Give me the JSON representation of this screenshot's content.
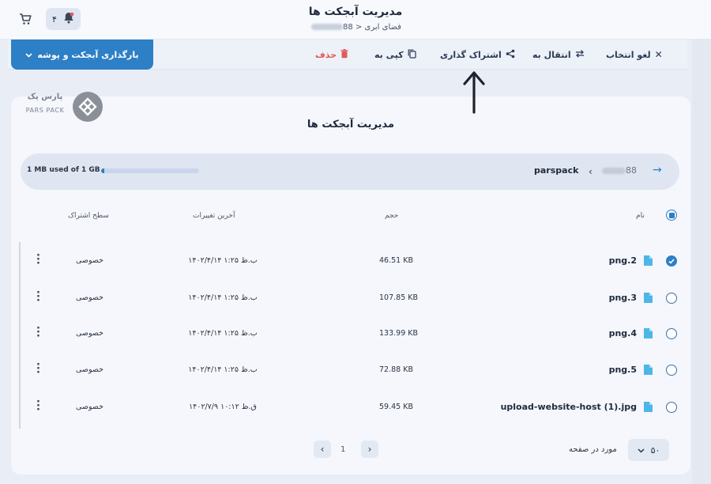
{
  "header": {
    "title": "مدیریت آبجکت ها",
    "breadcrumb_root": "فضای ابری",
    "breadcrumb_sep": "<",
    "breadcrumb_id_suffix": "88",
    "notification_count": "۴"
  },
  "toolbar": {
    "upload_label": "بارگذاری آبجکت و پوشه",
    "deselect_label": "لغو انتخاب",
    "move_label": "انتقال به",
    "share_label": "اشتراک گذاری",
    "copy_label": "کپی به",
    "delete_label": "حذف"
  },
  "brand": {
    "name": "پارس پک",
    "latin": "PARS PACK"
  },
  "card": {
    "title": "مدیریت آبجکت ها"
  },
  "pathbar": {
    "usage_text": "1 MB used of 1 GB",
    "usage_fraction": 0.001,
    "bucket": "parspack",
    "id_suffix": "88"
  },
  "table": {
    "headers": {
      "name": "نام",
      "size": "حجم",
      "modified": "آخرین تغییرات",
      "access": "سطح اشتراک"
    },
    "rows": [
      {
        "name": "png.2",
        "size": "46.51 KB",
        "modified": "۱۴۰۲/۴/۱۴ ۱:۲۵ ب.ظ",
        "access": "خصوصی",
        "selected": true
      },
      {
        "name": "png.3",
        "size": "107.85 KB",
        "modified": "۱۴۰۲/۴/۱۴ ۱:۲۵ ب.ظ",
        "access": "خصوصی",
        "selected": false
      },
      {
        "name": "png.4",
        "size": "133.99 KB",
        "modified": "۱۴۰۲/۴/۱۴ ۱:۲۵ ب.ظ",
        "access": "خصوصی",
        "selected": false
      },
      {
        "name": "png.5",
        "size": "72.88 KB",
        "modified": "۱۴۰۲/۴/۱۴ ۱:۲۵ ب.ظ",
        "access": "خصوصی",
        "selected": false
      },
      {
        "name": "upload-website-host (1).jpg",
        "size": "59.45 KB",
        "modified": "۱۴۰۲/۷/۹ ۱۰:۱۲ ق.ظ",
        "access": "خصوصی",
        "selected": false
      }
    ]
  },
  "pagination": {
    "current_page": "1",
    "per_page_label": "مورد در صفحه",
    "per_page_value": "۵۰"
  },
  "colors": {
    "accent": "#2d7fc6",
    "danger": "#e05a5a",
    "file_icon": "#4db6e8"
  }
}
